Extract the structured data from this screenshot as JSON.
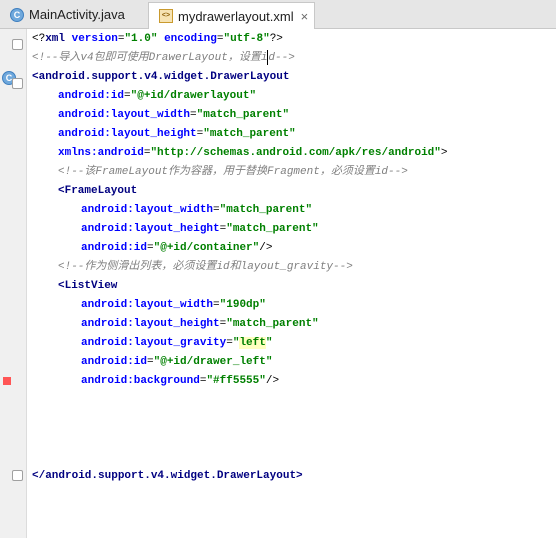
{
  "tabs": [
    {
      "label": "MainActivity.java",
      "icon": "class-icon",
      "active": false
    },
    {
      "label": "mydrawerlayout.xml",
      "icon": "xml-file-icon",
      "active": true,
      "close": "×"
    }
  ],
  "gutter": {
    "c_badge": "C"
  },
  "code": {
    "l1_open": "<?",
    "l1_tag": "xml ",
    "l1_a1": "version",
    "l1_eq1": "=",
    "l1_v1": "\"1.0\"",
    "l1_sp": " ",
    "l1_a2": "encoding",
    "l1_eq2": "=",
    "l1_v2": "\"utf-8\"",
    "l1_close": "?>",
    "l2_cmt_a": "<!--导入v4包即可使用DrawerLayout，设置i",
    "l2_cmt_b": "d-->",
    "l3": "<android.support.v4.widget.DrawerLayout",
    "l4_a": "android:id",
    "l4_eq": "=",
    "l4_v": "\"@+id/drawerlayout\"",
    "l5_a": "android:layout_width",
    "l5_eq": "=",
    "l5_v": "\"match_parent\"",
    "l6_a": "android:layout_height",
    "l6_eq": "=",
    "l6_v": "\"match_parent\"",
    "l7_a": "xmlns:android",
    "l7_eq": "=",
    "l7_v": "\"http://schemas.android.com/apk/res/android\"",
    "l7_end": ">",
    "l8_cmt": "<!--该FrameLayout作为容器，用于替换Fragment，必须设置id-->",
    "l9": "<FrameLayout",
    "l10_a": "android:layout_width",
    "l10_eq": "=",
    "l10_v": "\"match_parent\"",
    "l11_a": "android:layout_height",
    "l11_eq": "=",
    "l11_v": "\"match_parent\"",
    "l12_a": "android:id",
    "l12_eq": "=",
    "l12_v": "\"@+id/container\"",
    "l12_end": "/>",
    "l13_cmt": "<!--作为侧滑出列表，必须设置id和layout_gravity-->",
    "l14": "<ListView",
    "l15_a": "android:layout_width",
    "l15_eq": "=",
    "l15_v": "\"190dp\"",
    "l16_a": "android:layout_height",
    "l16_eq": "=",
    "l16_v": "\"match_parent\"",
    "l17_a": "android:layout_gravity",
    "l17_eq": "=",
    "l17_q1": "\"",
    "l17_v": "left",
    "l17_q2": "\"",
    "l18_a": "android:id",
    "l18_eq": "=",
    "l18_v": "\"@+id/drawer_left\"",
    "l19_a": "android:background",
    "l19_eq": "=",
    "l19_v": "\"#ff5555\"",
    "l19_end": "/>",
    "l20": "</android.support.v4.widget.DrawerLayout>"
  },
  "colors": {
    "background_swatch": "#ff5555",
    "tag": "#000080",
    "attr": "#0000ff",
    "value": "#008000",
    "comment": "#808080"
  }
}
